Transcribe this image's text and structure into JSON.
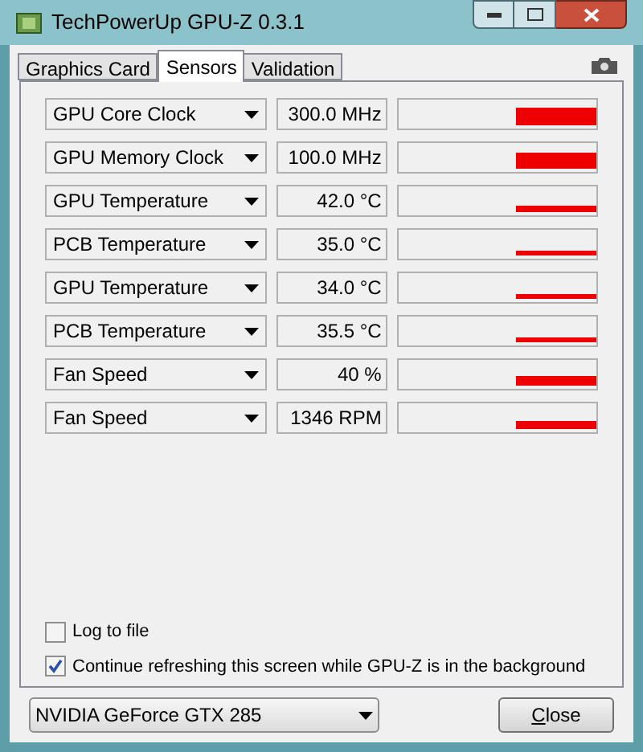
{
  "window": {
    "title": "TechPowerUp GPU-Z 0.3.1"
  },
  "tabs": [
    {
      "label": "Graphics Card",
      "selected": false
    },
    {
      "label": "Sensors",
      "selected": true
    },
    {
      "label": "Validation",
      "selected": false
    }
  ],
  "sensors": [
    {
      "name": "GPU Core Clock",
      "reading": "300.0 MHz"
    },
    {
      "name": "GPU Memory Clock",
      "reading": "100.0 MHz"
    },
    {
      "name": "GPU Temperature",
      "reading": "42.0 °C"
    },
    {
      "name": "PCB Temperature",
      "reading": "35.0 °C"
    },
    {
      "name": "GPU Temperature",
      "reading": "34.0 °C"
    },
    {
      "name": "PCB Temperature",
      "reading": "35.5 °C"
    },
    {
      "name": "Fan Speed",
      "reading": "40 %"
    },
    {
      "name": "Fan Speed",
      "reading": "1346 RPM"
    }
  ],
  "options": [
    {
      "label": "Log to file",
      "checked": false
    },
    {
      "label": "Continue refreshing this screen while GPU-Z is in the background",
      "checked": true
    }
  ],
  "device": {
    "value": "NVIDIA GeForce GTX 285"
  },
  "close_button": "Close"
}
